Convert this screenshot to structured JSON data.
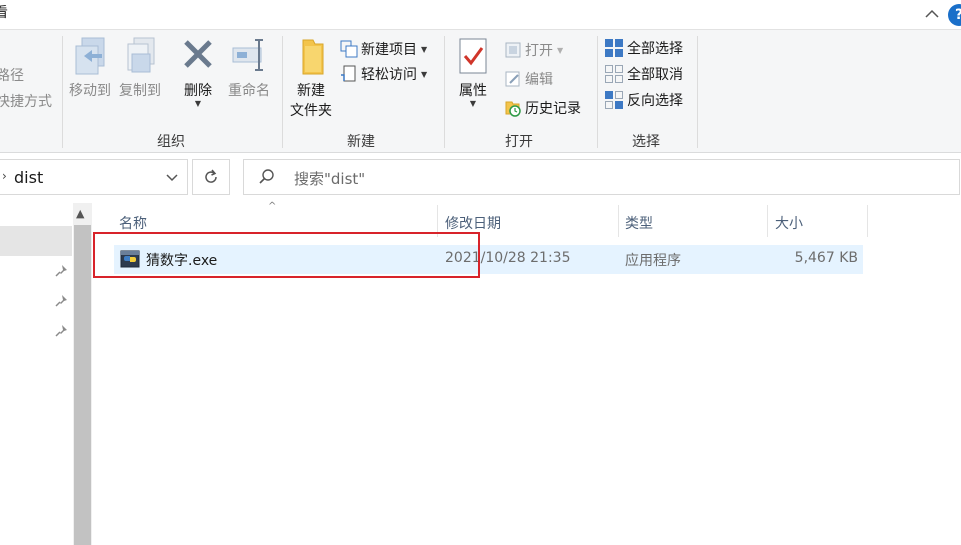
{
  "tabs": {
    "current_tab_label": "看"
  },
  "ribbon": {
    "clipboard_partial": {
      "line1": "路径",
      "line2": "快捷方式"
    },
    "organize": {
      "label": "组织",
      "move_to": "移动到",
      "copy_to": "复制到",
      "delete": "删除",
      "rename": "重命名"
    },
    "new": {
      "label": "新建",
      "new_folder_line1": "新建",
      "new_folder_line2": "文件夹",
      "new_item": "新建项目",
      "easy_access": "轻松访问"
    },
    "open": {
      "label": "打开",
      "properties": "属性",
      "open": "打开",
      "edit": "编辑",
      "history": "历史记录"
    },
    "select": {
      "label": "选择",
      "select_all": "全部选择",
      "select_none": "全部取消",
      "invert": "反向选择"
    }
  },
  "address": {
    "path": "dist"
  },
  "search": {
    "placeholder": "搜索\"dist\""
  },
  "file_list": {
    "columns": [
      "名称",
      "修改日期",
      "类型",
      "大小"
    ],
    "rows": [
      {
        "name": "猜数字.exe",
        "modified": "2021/10/28 21:35",
        "type": "应用程序",
        "size": "5,467 KB"
      }
    ]
  },
  "colors": {
    "accent": "#1a6fc9",
    "selection": "#e5f3ff",
    "highlight_box": "#d8232a"
  }
}
